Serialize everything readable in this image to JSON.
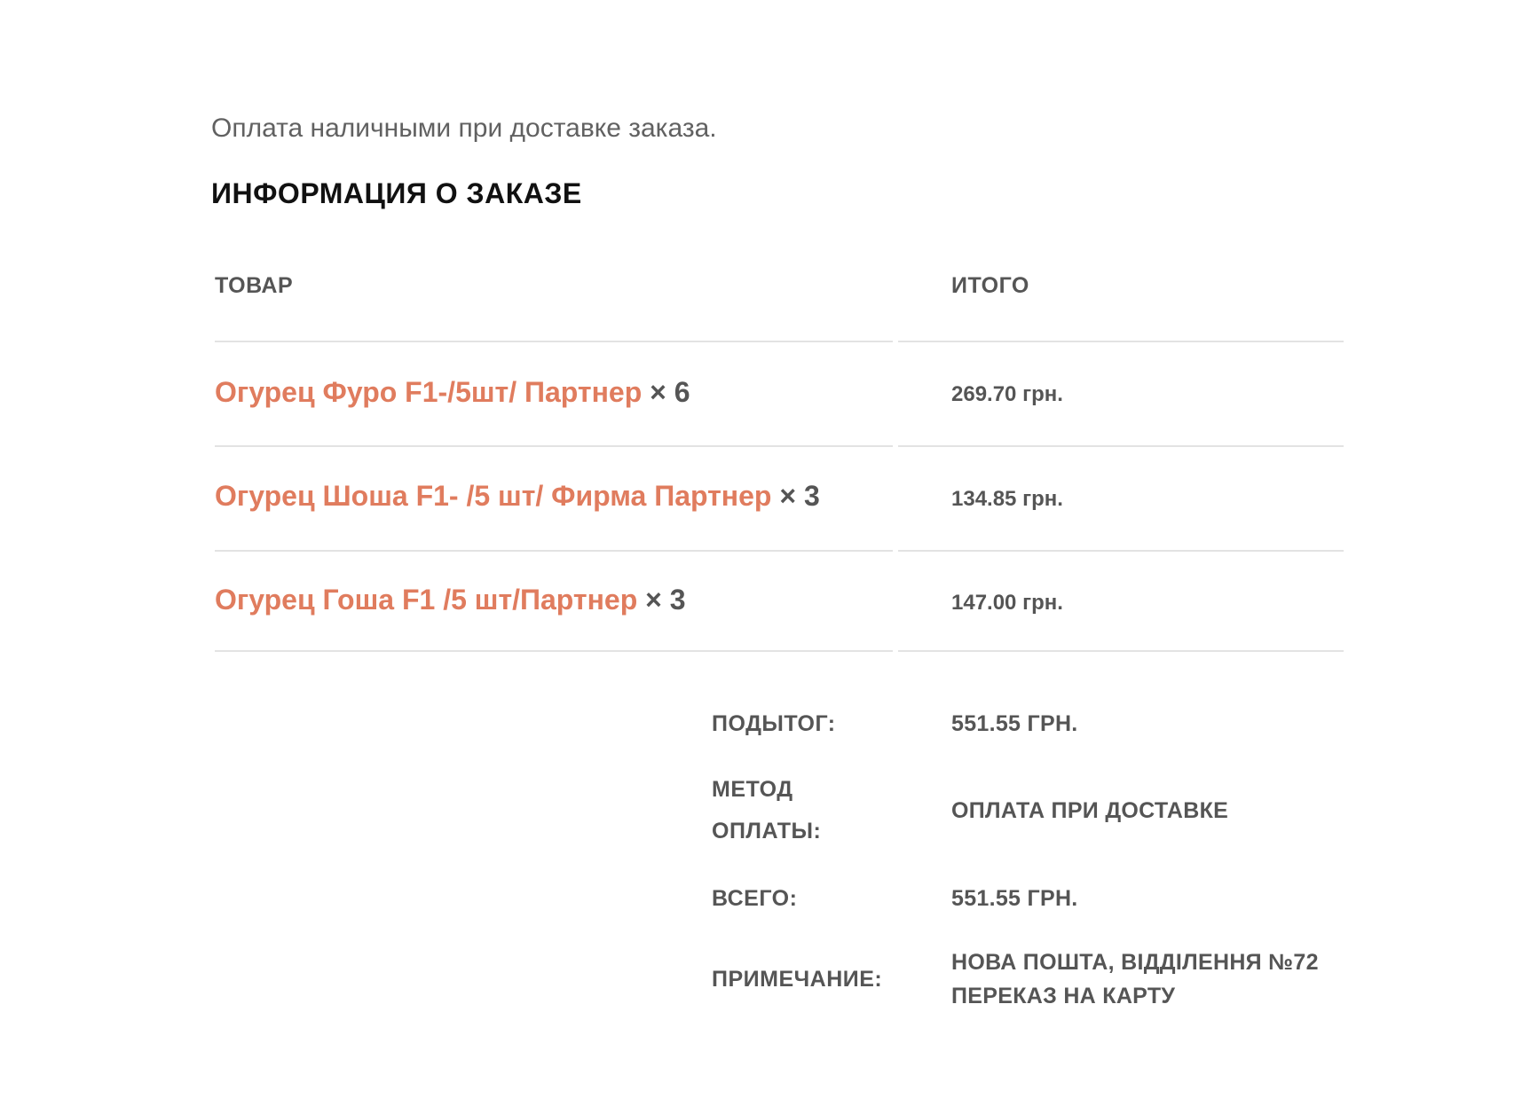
{
  "payment_note": "Оплата наличными при доставке заказа.",
  "section_title": "ИНФОРМАЦИЯ О ЗАКАЗЕ",
  "table": {
    "headers": {
      "product": "ТОВАР",
      "total": "ИТОГО"
    },
    "items": [
      {
        "name": "Огурец Фуро F1-/5шт/ Партнер",
        "qty": "× 6",
        "price": "269.70 грн."
      },
      {
        "name": "Огурец Шоша F1- /5 шт/ Фирма Партнер",
        "qty": "× 3",
        "price": "134.85 грн."
      },
      {
        "name": "Огурец Гоша F1 /5 шт/Партнер",
        "qty": "× 3",
        "price": "147.00 грн."
      }
    ]
  },
  "summary": {
    "subtotal_label": "ПОДЫТОГ:",
    "subtotal_value": "551.55 ГРН.",
    "payment_method_label_line1": "МЕТОД",
    "payment_method_label_line2": "ОПЛАТЫ:",
    "payment_method_value": "ОПЛАТА ПРИ ДОСТАВКЕ",
    "total_label": "ВСЕГО:",
    "total_value": "551.55 ГРН.",
    "note_label": "ПРИМЕЧАНИЕ:",
    "note_value_line1": "НОВА ПОШТА, ВІДДІЛЕННЯ №72",
    "note_value_line2": "ПЕРЕКАЗ НА КАРТУ"
  },
  "colors": {
    "link": "#e07c5e",
    "text": "#555555",
    "heading": "#111111",
    "divider": "#e3e3e3"
  }
}
